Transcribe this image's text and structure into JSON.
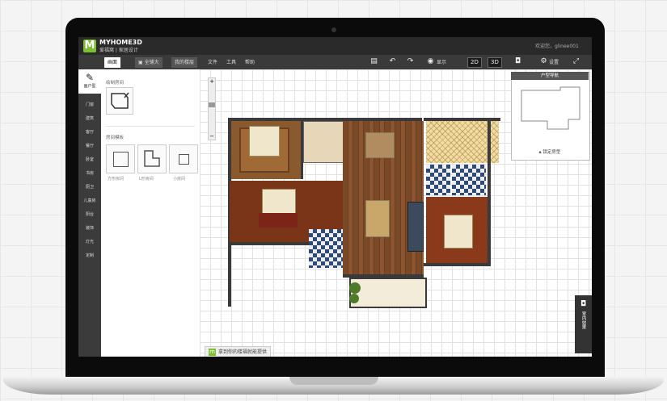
{
  "app": {
    "logo_letter": "M",
    "brand": "MYHOME3D",
    "brand_sub": "爱福窝 | 家居设计",
    "welcome": "欢迎您，glinee001"
  },
  "tabs": [
    {
      "label": "画面"
    },
    {
      "label": "▣ 全铺大"
    },
    {
      "label": "我的楼层"
    }
  ],
  "menu": [
    "文件",
    "工具",
    "帮助"
  ],
  "toolbar": {
    "view_label": "显示",
    "mode_2d": "2D",
    "mode_3d": "3D",
    "settings_label": "设置"
  },
  "leftnav": {
    "home": "画户型",
    "items": [
      "门窗",
      "建筑",
      "客厅",
      "餐厅",
      "卧室",
      "书房",
      "厨卫",
      "儿童房",
      "阳台",
      "装饰",
      "灯光",
      "定制"
    ]
  },
  "panel": {
    "draw_title": "绘制房间",
    "shape_title": "房间模板",
    "shapes": [
      "方形房间",
      "L形房间",
      "小房间"
    ]
  },
  "minimap": {
    "title": "户型导航",
    "lock_label": "锁定房型"
  },
  "sidetab": "室内效果",
  "hint": "拿到你的楼福就能提供",
  "colors": {
    "brand_green": "#7cbf2f",
    "topbar": "#2a2a2a",
    "leftnav": "#3b3b3b"
  }
}
